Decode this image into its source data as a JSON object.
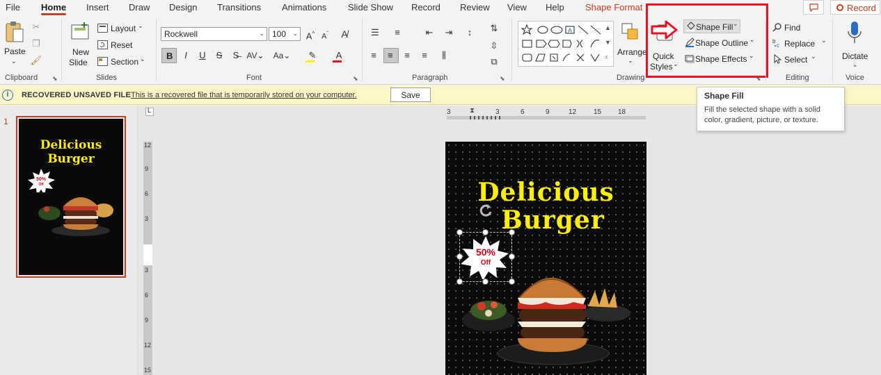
{
  "tabs": [
    "File",
    "Home",
    "Insert",
    "Draw",
    "Design",
    "Transitions",
    "Animations",
    "Slide Show",
    "Record",
    "Review",
    "View",
    "Help",
    "Shape Format"
  ],
  "active_tab": "Home",
  "top_right": {
    "record_label": "Record"
  },
  "ribbon": {
    "clipboard": {
      "paste_label": "Paste",
      "group_label": "Clipboard"
    },
    "slides": {
      "new_slide_label": "New",
      "new_slide_label2": "Slide",
      "layout_label": "Layout",
      "reset_label": "Reset",
      "section_label": "Section",
      "group_label": "Slides"
    },
    "font": {
      "font_name": "Rockwell",
      "font_size": "100",
      "bold": "B",
      "italic": "I",
      "underline": "U",
      "strike": "S",
      "group_label": "Font"
    },
    "paragraph": {
      "group_label": "Paragraph"
    },
    "drawing": {
      "arrange_label": "Arrange",
      "quick_styles_label": "Quick",
      "quick_styles_label2": "Styles",
      "shape_fill_label": "Shape Fill",
      "shape_outline_label": "Shape Outline",
      "shape_effects_label": "Shape Effects",
      "group_label": "Drawing"
    },
    "editing": {
      "find_label": "Find",
      "replace_label": "Replace",
      "select_label": "Select",
      "group_label": "Editing"
    },
    "voice": {
      "dictate_label": "Dictate",
      "group_label": "Voice"
    }
  },
  "infobar": {
    "title": "RECOVERED UNSAVED FILE",
    "message": "This is a recovered file that is temporarily stored on your computer.",
    "save_label": "Save"
  },
  "tooltip": {
    "title": "Shape Fill",
    "body": "Fill the selected shape with a solid color, gradient, picture, or texture."
  },
  "thumbnail": {
    "slide_number": "1"
  },
  "slide": {
    "title_line1": "Delicious",
    "title_line2": "Burger",
    "badge_line1": "50%",
    "badge_line2": "Off"
  },
  "ruler": {
    "horizontal": [
      "3",
      "3",
      "6",
      "9",
      "12",
      "15",
      "18"
    ],
    "vertical": [
      "12",
      "9",
      "6",
      "3",
      "3",
      "6",
      "9",
      "12",
      "15"
    ]
  },
  "colors": {
    "accent": "#b7472a",
    "contextual_tab": "#c43e1c",
    "highlight_box": "#e81123",
    "title_yellow": "#ffef00",
    "badge_red": "#d0021b"
  }
}
